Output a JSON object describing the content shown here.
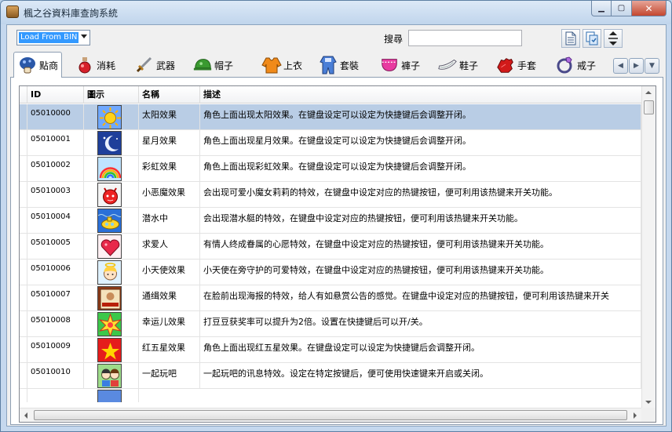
{
  "window": {
    "title": "楓之谷資料庫查詢系統"
  },
  "toolbar": {
    "source_value": "Load From BIN",
    "search_label": "搜尋",
    "search_value": "",
    "search_placeholder": ""
  },
  "tabs": [
    {
      "label": "點商",
      "icon": "mushroom-icon",
      "active": true
    },
    {
      "label": "消耗",
      "icon": "potion-icon"
    },
    {
      "label": "武器",
      "icon": "sword-icon"
    },
    {
      "label": "帽子",
      "icon": "cap-icon"
    },
    {
      "label": "上衣",
      "icon": "shirt-icon"
    },
    {
      "label": "套裝",
      "icon": "overall-icon"
    },
    {
      "label": "褲子",
      "icon": "pants-icon"
    },
    {
      "label": "鞋子",
      "icon": "shoe-icon"
    },
    {
      "label": "手套",
      "icon": "glove-icon"
    },
    {
      "label": "戒子",
      "icon": "ring-icon"
    }
  ],
  "table": {
    "columns": [
      "ID",
      "圖示",
      "名稱",
      "描述"
    ],
    "rows": [
      {
        "id": "05010000",
        "icon": "sun-icon",
        "name": "太阳效果",
        "desc": "角色上面出现太阳效果。在键盘设定可以设定为快捷键后会调整开闭。",
        "selected": true
      },
      {
        "id": "05010001",
        "icon": "moon-icon",
        "name": "星月效果",
        "desc": "角色上面出现星月效果。在键盘设定可以设定为快捷键后会调整开闭。"
      },
      {
        "id": "05010002",
        "icon": "rainbow-icon",
        "name": "彩虹效果",
        "desc": "角色上面出现彩虹效果。在键盘设定可以设定为快捷键后会调整开闭。"
      },
      {
        "id": "05010003",
        "icon": "devil-icon",
        "name": "小恶魔效果",
        "desc": "会出现可爱小魔女莉莉的特效，在键盘中设定对应的热键按钮，便可利用该热键来开关功能。"
      },
      {
        "id": "05010004",
        "icon": "submarine-icon",
        "name": "潜水中",
        "desc": "会出现潜水艇的特效，在键盘中设定对应的热键按钮，便可利用该热键来开关功能。"
      },
      {
        "id": "05010005",
        "icon": "heart-icon",
        "name": "求爱人",
        "desc": "有情人终成眷属的心愿特效，在键盘中设定对应的热键按钮，便可利用该热键来开关功能。"
      },
      {
        "id": "05010006",
        "icon": "angel-icon",
        "name": "小天使效果",
        "desc": "小天使在旁守护的可爱特效，在键盘中设定对应的热键按钮，便可利用该热键来开关功能。"
      },
      {
        "id": "05010007",
        "icon": "wanted-icon",
        "name": "通缉效果",
        "desc": "在脸前出现海报的特效，给人有如悬赏公告的感觉。在键盘中设定对应的热键按钮，便可利用该热键来开关"
      },
      {
        "id": "05010008",
        "icon": "star-burst-icon",
        "name": "幸运儿效果",
        "desc": "打豆豆获奖率可以提升为2倍。设置在快捷键后可以开/关。"
      },
      {
        "id": "05010009",
        "icon": "red-star-icon",
        "name": "红五星效果",
        "desc": "角色上面出现红五星效果。在键盘设定可以设定为快捷键后会调整开闭。"
      },
      {
        "id": "05010010",
        "icon": "friends-icon",
        "name": "一起玩吧",
        "desc": "一起玩吧的讯息特效。设定在特定按键后，便可使用快速键来开启或关闭。"
      }
    ]
  }
}
